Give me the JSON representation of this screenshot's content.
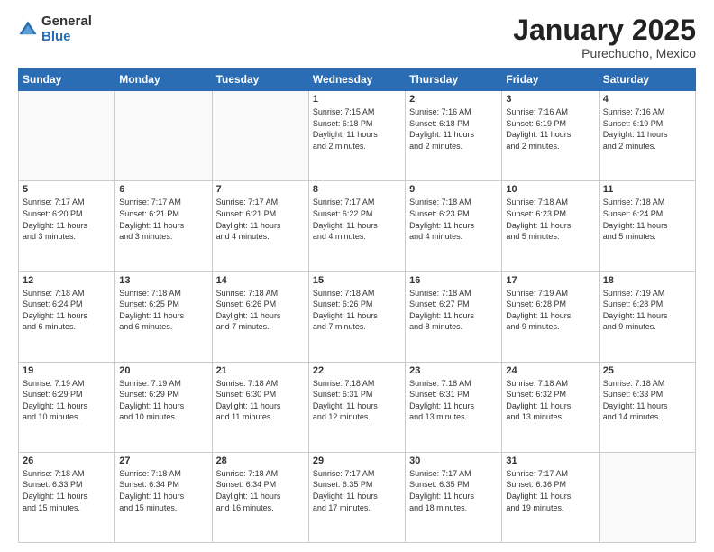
{
  "logo": {
    "general": "General",
    "blue": "Blue"
  },
  "header": {
    "month": "January 2025",
    "location": "Purechucho, Mexico"
  },
  "weekdays": [
    "Sunday",
    "Monday",
    "Tuesday",
    "Wednesday",
    "Thursday",
    "Friday",
    "Saturday"
  ],
  "weeks": [
    [
      {
        "day": "",
        "info": ""
      },
      {
        "day": "",
        "info": ""
      },
      {
        "day": "",
        "info": ""
      },
      {
        "day": "1",
        "info": "Sunrise: 7:15 AM\nSunset: 6:18 PM\nDaylight: 11 hours\nand 2 minutes."
      },
      {
        "day": "2",
        "info": "Sunrise: 7:16 AM\nSunset: 6:18 PM\nDaylight: 11 hours\nand 2 minutes."
      },
      {
        "day": "3",
        "info": "Sunrise: 7:16 AM\nSunset: 6:19 PM\nDaylight: 11 hours\nand 2 minutes."
      },
      {
        "day": "4",
        "info": "Sunrise: 7:16 AM\nSunset: 6:19 PM\nDaylight: 11 hours\nand 2 minutes."
      }
    ],
    [
      {
        "day": "5",
        "info": "Sunrise: 7:17 AM\nSunset: 6:20 PM\nDaylight: 11 hours\nand 3 minutes."
      },
      {
        "day": "6",
        "info": "Sunrise: 7:17 AM\nSunset: 6:21 PM\nDaylight: 11 hours\nand 3 minutes."
      },
      {
        "day": "7",
        "info": "Sunrise: 7:17 AM\nSunset: 6:21 PM\nDaylight: 11 hours\nand 4 minutes."
      },
      {
        "day": "8",
        "info": "Sunrise: 7:17 AM\nSunset: 6:22 PM\nDaylight: 11 hours\nand 4 minutes."
      },
      {
        "day": "9",
        "info": "Sunrise: 7:18 AM\nSunset: 6:23 PM\nDaylight: 11 hours\nand 4 minutes."
      },
      {
        "day": "10",
        "info": "Sunrise: 7:18 AM\nSunset: 6:23 PM\nDaylight: 11 hours\nand 5 minutes."
      },
      {
        "day": "11",
        "info": "Sunrise: 7:18 AM\nSunset: 6:24 PM\nDaylight: 11 hours\nand 5 minutes."
      }
    ],
    [
      {
        "day": "12",
        "info": "Sunrise: 7:18 AM\nSunset: 6:24 PM\nDaylight: 11 hours\nand 6 minutes."
      },
      {
        "day": "13",
        "info": "Sunrise: 7:18 AM\nSunset: 6:25 PM\nDaylight: 11 hours\nand 6 minutes."
      },
      {
        "day": "14",
        "info": "Sunrise: 7:18 AM\nSunset: 6:26 PM\nDaylight: 11 hours\nand 7 minutes."
      },
      {
        "day": "15",
        "info": "Sunrise: 7:18 AM\nSunset: 6:26 PM\nDaylight: 11 hours\nand 7 minutes."
      },
      {
        "day": "16",
        "info": "Sunrise: 7:18 AM\nSunset: 6:27 PM\nDaylight: 11 hours\nand 8 minutes."
      },
      {
        "day": "17",
        "info": "Sunrise: 7:19 AM\nSunset: 6:28 PM\nDaylight: 11 hours\nand 9 minutes."
      },
      {
        "day": "18",
        "info": "Sunrise: 7:19 AM\nSunset: 6:28 PM\nDaylight: 11 hours\nand 9 minutes."
      }
    ],
    [
      {
        "day": "19",
        "info": "Sunrise: 7:19 AM\nSunset: 6:29 PM\nDaylight: 11 hours\nand 10 minutes."
      },
      {
        "day": "20",
        "info": "Sunrise: 7:19 AM\nSunset: 6:29 PM\nDaylight: 11 hours\nand 10 minutes."
      },
      {
        "day": "21",
        "info": "Sunrise: 7:18 AM\nSunset: 6:30 PM\nDaylight: 11 hours\nand 11 minutes."
      },
      {
        "day": "22",
        "info": "Sunrise: 7:18 AM\nSunset: 6:31 PM\nDaylight: 11 hours\nand 12 minutes."
      },
      {
        "day": "23",
        "info": "Sunrise: 7:18 AM\nSunset: 6:31 PM\nDaylight: 11 hours\nand 13 minutes."
      },
      {
        "day": "24",
        "info": "Sunrise: 7:18 AM\nSunset: 6:32 PM\nDaylight: 11 hours\nand 13 minutes."
      },
      {
        "day": "25",
        "info": "Sunrise: 7:18 AM\nSunset: 6:33 PM\nDaylight: 11 hours\nand 14 minutes."
      }
    ],
    [
      {
        "day": "26",
        "info": "Sunrise: 7:18 AM\nSunset: 6:33 PM\nDaylight: 11 hours\nand 15 minutes."
      },
      {
        "day": "27",
        "info": "Sunrise: 7:18 AM\nSunset: 6:34 PM\nDaylight: 11 hours\nand 15 minutes."
      },
      {
        "day": "28",
        "info": "Sunrise: 7:18 AM\nSunset: 6:34 PM\nDaylight: 11 hours\nand 16 minutes."
      },
      {
        "day": "29",
        "info": "Sunrise: 7:17 AM\nSunset: 6:35 PM\nDaylight: 11 hours\nand 17 minutes."
      },
      {
        "day": "30",
        "info": "Sunrise: 7:17 AM\nSunset: 6:35 PM\nDaylight: 11 hours\nand 18 minutes."
      },
      {
        "day": "31",
        "info": "Sunrise: 7:17 AM\nSunset: 6:36 PM\nDaylight: 11 hours\nand 19 minutes."
      },
      {
        "day": "",
        "info": ""
      }
    ]
  ]
}
